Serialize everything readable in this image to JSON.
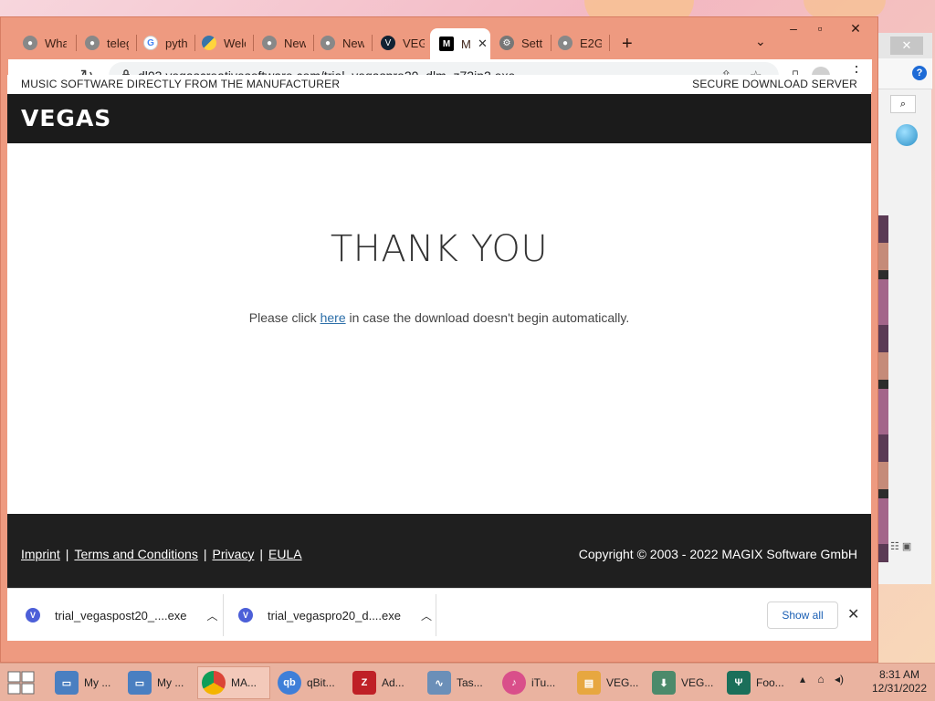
{
  "browser": {
    "tabs": [
      {
        "label": "What",
        "icon": "chrome-tab-icon"
      },
      {
        "label": "teleg",
        "icon": "chrome-tab-icon"
      },
      {
        "label": "pyth",
        "icon": "google-icon"
      },
      {
        "label": "Welc",
        "icon": "python-icon"
      },
      {
        "label": "New",
        "icon": "chrome-tab-icon"
      },
      {
        "label": "New",
        "icon": "chrome-tab-icon"
      },
      {
        "label": "VEGA",
        "icon": "vegas-icon"
      },
      {
        "label": "M",
        "icon": "magix-icon",
        "active": true
      },
      {
        "label": "Setti",
        "icon": "gear-icon"
      },
      {
        "label": "E2G",
        "icon": "chrome-tab-icon"
      }
    ],
    "url": "dl03.vegascreativesoftware.com/trial_vegaspro20_dlm_z72jp2.exe"
  },
  "page": {
    "top_left": "MUSIC SOFTWARE DIRECTLY FROM THE MANUFACTURER",
    "top_right": "SECURE DOWNLOAD SERVER",
    "logo": "VEGAS",
    "heading": "THANK YOU",
    "message_before": "Please click ",
    "message_link": "here",
    "message_after": " in case the download doesn't begin automatically.",
    "footer_links": [
      "Imprint",
      "Terms and Conditions",
      "Privacy",
      "EULA"
    ],
    "copyright": "Copyright © 2003 - 2022 MAGIX Software GmbH"
  },
  "downloads": {
    "items": [
      "trial_vegaspost20_....exe",
      "trial_vegaspro20_d....exe"
    ],
    "show_all": "Show all"
  },
  "taskbar": {
    "items": [
      {
        "label": "My ...",
        "icon": "computer-icon"
      },
      {
        "label": "My ...",
        "icon": "computer-icon"
      },
      {
        "label": "MA...",
        "icon": "chrome-icon",
        "active": true
      },
      {
        "label": "qBit...",
        "icon": "qbittorrent-icon"
      },
      {
        "label": "Ad...",
        "icon": "filezilla-icon"
      },
      {
        "label": "Tas...",
        "icon": "task-manager-icon"
      },
      {
        "label": "iTu...",
        "icon": "itunes-icon"
      },
      {
        "label": "VEG...",
        "icon": "vegas-folder-icon"
      },
      {
        "label": "VEG...",
        "icon": "installer-icon"
      },
      {
        "label": "Foo...",
        "icon": "food-app-icon"
      }
    ],
    "time": "8:31 AM",
    "date": "12/31/2022"
  },
  "background_window": {
    "help": "?"
  }
}
